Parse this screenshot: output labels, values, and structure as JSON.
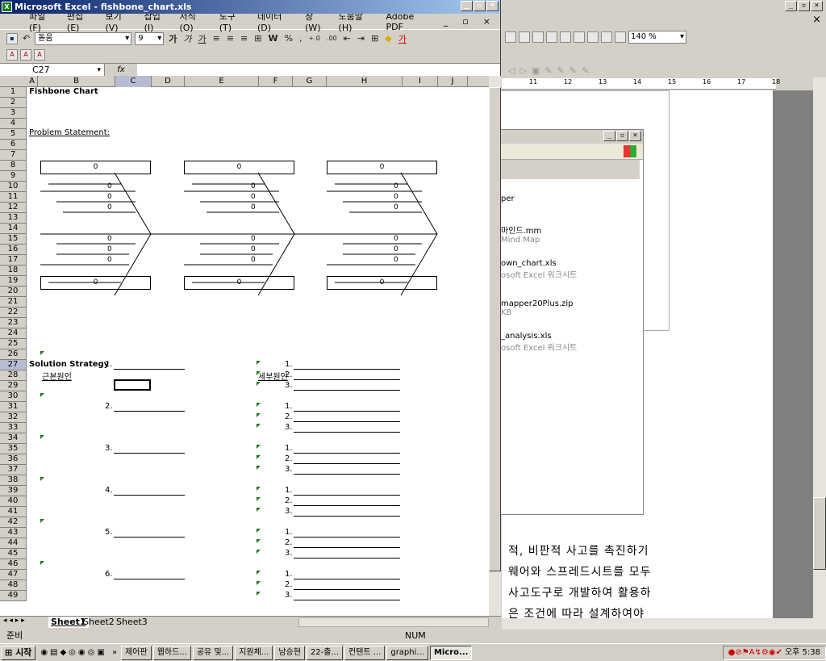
{
  "word": {
    "zoom": "140 %",
    "ruler_numbers": [
      "11",
      "12",
      "13",
      "14",
      "15",
      "16",
      "17",
      "18"
    ],
    "body_lines": [
      "적, 비판적 사고를 촉진하기",
      "웨어와 스프레드시트를 모두",
      "사고도구로 개발하여 활용하",
      "은 조건에 따라 설계하여야"
    ]
  },
  "explorer": {
    "items": [
      {
        "name": "per",
        "sub": ""
      },
      {
        "name": "마인드.mm",
        "sub": "Mind Map"
      },
      {
        "name": "own_chart.xls",
        "sub": "osoft Excel 워크시트"
      },
      {
        "name": "mapper20Plus.zip",
        "sub": "KB"
      },
      {
        "name": "_analysis.xls",
        "sub": "osoft Excel 워크시트"
      }
    ]
  },
  "excel": {
    "title": "Microsoft Excel - fishbone_chart.xls",
    "menu": [
      "파일(F)",
      "편집(E)",
      "보기(V)",
      "삽입(I)",
      "서식(O)",
      "도구(T)",
      "데이터(D)",
      "창(W)",
      "도움말(H)",
      "Adobe PDF"
    ],
    "font": "돋움",
    "size": "9",
    "toolbar_glyphs": [
      "가",
      "가",
      "가",
      "W",
      "%",
      ",",
      "+.0",
      ".00"
    ],
    "namebox": "C27",
    "fx": "fx",
    "columns": [
      "A",
      "B",
      "C",
      "D",
      "E",
      "F",
      "G",
      "H",
      "I",
      "J"
    ],
    "rows": [
      "1",
      "2",
      "3",
      "4",
      "5",
      "6",
      "7",
      "8",
      "9",
      "10",
      "11",
      "12",
      "13",
      "14",
      "15",
      "16",
      "17",
      "18",
      "19",
      "20",
      "21",
      "22",
      "23",
      "24",
      "25",
      "26",
      "27",
      "28",
      "29",
      "30",
      "31",
      "32",
      "33",
      "34",
      "35",
      "36",
      "37",
      "38",
      "39",
      "40",
      "41",
      "42",
      "43",
      "44",
      "45",
      "46",
      "47",
      "48",
      "49"
    ],
    "chart_title": "Fishbone Chart",
    "problem_label": "Problem Statement:",
    "solution_title": "Solution Strategy",
    "root_cause_label": "근본원인",
    "sub_cause_label": "세부원인",
    "zero": "0",
    "numbered": [
      "1.",
      "2.",
      "3.",
      "4.",
      "5.",
      "6."
    ],
    "sub_numbers": [
      "1.",
      "2.",
      "3."
    ],
    "sheets": [
      "Sheet1",
      "Sheet2",
      "Sheet3"
    ],
    "status_left": "준비",
    "status_num": "NUM"
  },
  "taskbar": {
    "start": "시작",
    "tasks": [
      "제어판",
      "웹하드...",
      "공유 및...",
      "지원체...",
      "남승현",
      "22-출...",
      "컨텐트 ...",
      "graphi...",
      "Micro..."
    ],
    "clock": "오후 5:38"
  }
}
